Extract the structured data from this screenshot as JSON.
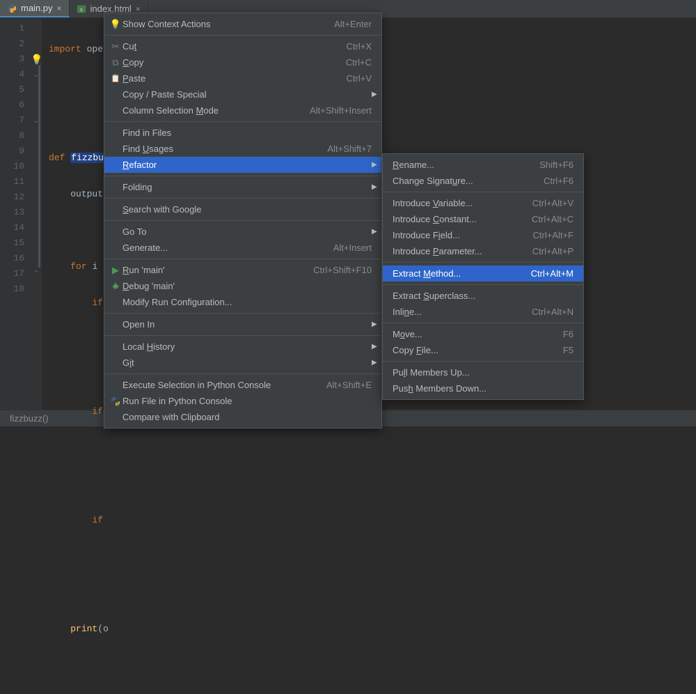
{
  "tabs": [
    {
      "label": "main.py",
      "active": true
    },
    {
      "label": "index.html",
      "active": false
    }
  ],
  "gutter": {
    "lines": [
      "1",
      "2",
      "3",
      "4",
      "5",
      "6",
      "7",
      "8",
      "9",
      "10",
      "11",
      "12",
      "13",
      "14",
      "15",
      "16",
      "17",
      "18"
    ]
  },
  "code": {
    "l1_kw": "import",
    "l1_id": "openai",
    "l4_kw": "def",
    "l4_fn": "fizzbuzz",
    "l4_after": "(",
    "l5_id": "output",
    "l7_kw": "for",
    "l7_id": "i",
    "l8_kw": "if",
    "l11_kw": "if",
    "l14_kw": "if",
    "l17_fn": "print",
    "l17_open": "(o"
  },
  "statusbar": {
    "text": "fizzbuzz()"
  },
  "context_menu": {
    "groups": [
      [
        {
          "icon": "bulb",
          "label": "Show Context Actions",
          "shortcut": "Alt+Enter",
          "sub": false
        }
      ],
      [
        {
          "icon": "scissors",
          "label": "Cu_t_",
          "shortcut": "Ctrl+X",
          "sub": false
        },
        {
          "icon": "copy",
          "label": "_C_opy",
          "shortcut": "Ctrl+C",
          "sub": false
        },
        {
          "icon": "paste",
          "label": "_P_aste",
          "shortcut": "Ctrl+V",
          "sub": false
        },
        {
          "icon": "",
          "label": "Copy / Paste Special",
          "shortcut": "",
          "sub": true
        },
        {
          "icon": "",
          "label": "Column Selection _M_ode",
          "shortcut": "Alt+Shift+Insert",
          "sub": false
        }
      ],
      [
        {
          "icon": "",
          "label": "Find in Files",
          "shortcut": "",
          "sub": false
        },
        {
          "icon": "",
          "label": "Find _U_sages",
          "shortcut": "Alt+Shift+7",
          "sub": false
        },
        {
          "icon": "",
          "label": "_R_efactor",
          "shortcut": "",
          "sub": true,
          "highlight": true
        }
      ],
      [
        {
          "icon": "",
          "label": "Folding",
          "shortcut": "",
          "sub": true
        }
      ],
      [
        {
          "icon": "",
          "label": "_S_earch with Google",
          "shortcut": "",
          "sub": false
        }
      ],
      [
        {
          "icon": "",
          "label": "Go To",
          "shortcut": "",
          "sub": true
        },
        {
          "icon": "",
          "label": "Generate...",
          "shortcut": "Alt+Insert",
          "sub": false
        }
      ],
      [
        {
          "icon": "play",
          "label": "_R_un 'main'",
          "shortcut": "Ctrl+Shift+F10",
          "sub": false
        },
        {
          "icon": "bug",
          "label": "_D_ebug 'main'",
          "shortcut": "",
          "sub": false
        },
        {
          "icon": "",
          "label": "Modify Run Configuration...",
          "shortcut": "",
          "sub": false
        }
      ],
      [
        {
          "icon": "",
          "label": "Open In",
          "shortcut": "",
          "sub": true
        }
      ],
      [
        {
          "icon": "",
          "label": "Local _H_istory",
          "shortcut": "",
          "sub": true
        },
        {
          "icon": "",
          "label": "G_i_t",
          "shortcut": "",
          "sub": true
        }
      ],
      [
        {
          "icon": "",
          "label": "Execute Selection in Python Console",
          "shortcut": "Alt+Shift+E",
          "sub": false
        },
        {
          "icon": "pyrun",
          "label": "Run File in Python Console",
          "shortcut": "",
          "sub": false
        },
        {
          "icon": "",
          "label": "Compare with Clipboard",
          "shortcut": "",
          "sub": false
        }
      ]
    ]
  },
  "refactor_submenu": {
    "groups": [
      [
        {
          "label": "_R_ename...",
          "shortcut": "Shift+F6"
        },
        {
          "label": "Change Signat_u_re...",
          "shortcut": "Ctrl+F6"
        }
      ],
      [
        {
          "label": "Introduce _V_ariable...",
          "shortcut": "Ctrl+Alt+V"
        },
        {
          "label": "Introduce _C_onstant...",
          "shortcut": "Ctrl+Alt+C"
        },
        {
          "label": "Introduce F_i_eld...",
          "shortcut": "Ctrl+Alt+F"
        },
        {
          "label": "Introduce _P_arameter...",
          "shortcut": "Ctrl+Alt+P"
        }
      ],
      [
        {
          "label": "Extract _M_ethod...",
          "shortcut": "Ctrl+Alt+M",
          "highlight": true
        }
      ],
      [
        {
          "label": "Extract _S_uperclass...",
          "shortcut": ""
        },
        {
          "label": "Inli_n_e...",
          "shortcut": "Ctrl+Alt+N"
        }
      ],
      [
        {
          "label": "M_o_ve...",
          "shortcut": "F6"
        },
        {
          "label": "Copy _F_ile...",
          "shortcut": "F5"
        }
      ],
      [
        {
          "label": "Pu_l_l Members Up...",
          "shortcut": ""
        },
        {
          "label": "Pus_h_ Members Down...",
          "shortcut": ""
        }
      ]
    ]
  }
}
